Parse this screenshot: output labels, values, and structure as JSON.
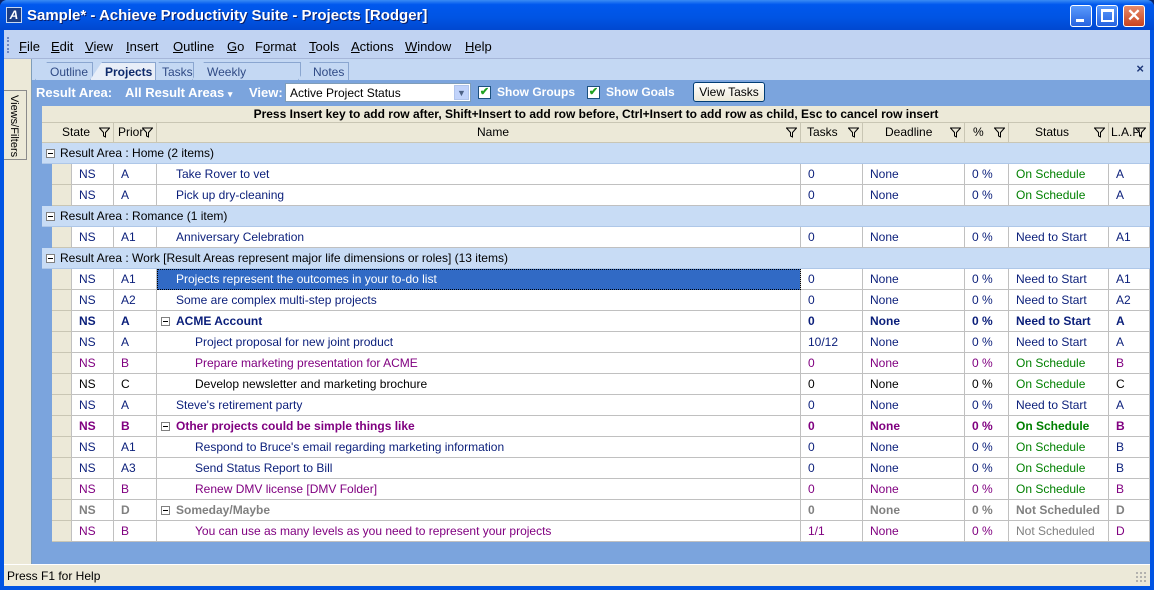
{
  "window": {
    "title": "Sample* - Achieve Productivity Suite - Projects [Rodger]",
    "icon": "app-logo-icon",
    "controls": [
      "minimize",
      "maximize",
      "close"
    ]
  },
  "menu": [
    {
      "label": "File",
      "accel": "F"
    },
    {
      "label": "Edit",
      "accel": "E"
    },
    {
      "label": "View",
      "accel": "V"
    },
    {
      "label": "Insert",
      "accel": "I"
    },
    {
      "label": "Outline",
      "accel": "O"
    },
    {
      "label": "Go",
      "accel": "G"
    },
    {
      "label": "Format",
      "accel": "o"
    },
    {
      "label": "Tools",
      "accel": "T"
    },
    {
      "label": "Actions",
      "accel": "A"
    },
    {
      "label": "Window",
      "accel": "W"
    },
    {
      "label": "Help",
      "accel": "H"
    }
  ],
  "sidebar": {
    "label": "Views/Filters"
  },
  "tabs": [
    {
      "label": "Outline",
      "active": false
    },
    {
      "label": "Projects",
      "active": true
    },
    {
      "label": "Tasks",
      "active": false
    },
    {
      "label": "Weekly Schedule",
      "active": false
    },
    {
      "label": "Notes",
      "active": false
    }
  ],
  "tab_close": "×",
  "filterbar": {
    "result_area_label": "Result Area:",
    "result_area_value": "All Result Areas",
    "view_label": "View:",
    "view_value": "Active Project Status",
    "show_groups_label": "Show Groups",
    "show_groups_checked": true,
    "show_goals_label": "Show Goals",
    "show_goals_checked": true,
    "view_tasks_button": "View Tasks"
  },
  "hint": "Press Insert key to add row after, Shift+Insert to add row before, Ctrl+Insert to add row as child, Esc to cancel row insert",
  "columns": [
    {
      "key": "state",
      "label": "State"
    },
    {
      "key": "prior",
      "label": "Prior"
    },
    {
      "key": "name",
      "label": "Name"
    },
    {
      "key": "tasks",
      "label": "Tasks"
    },
    {
      "key": "deadline",
      "label": "Deadline"
    },
    {
      "key": "pct",
      "label": "%"
    },
    {
      "key": "status",
      "label": "Status"
    },
    {
      "key": "lap",
      "label": "L.A.P."
    }
  ],
  "colors": {
    "navy": "#0a1e7a",
    "purple": "#800080",
    "green": "#008000",
    "gray": "#808080",
    "black": "#000000",
    "selection": "#316ac5",
    "group_bg": "#c8dcf5",
    "pane_bg": "#7ba4dd"
  },
  "groups": [
    {
      "label": "Result Area : Home (2 items)",
      "rows": [
        {
          "state": "NS",
          "prior": "A",
          "name": "Take Rover to vet",
          "tasks": "0",
          "deadline": "None",
          "pct": "0 %",
          "status": "On Schedule",
          "lap": "A",
          "level": 0,
          "color": "navy",
          "status_color": "green",
          "bold": false
        },
        {
          "state": "NS",
          "prior": "A",
          "name": "Pick up dry-cleaning",
          "tasks": "0",
          "deadline": "None",
          "pct": "0 %",
          "status": "On Schedule",
          "lap": "A",
          "level": 0,
          "color": "navy",
          "status_color": "green",
          "bold": false
        }
      ]
    },
    {
      "label": "Result Area : Romance (1 item)",
      "rows": [
        {
          "state": "NS",
          "prior": "A1",
          "name": "Anniversary Celebration",
          "tasks": "0",
          "deadline": "None",
          "pct": "0 %",
          "status": "Need to Start",
          "lap": "A1",
          "level": 0,
          "color": "navy",
          "status_color": "navy",
          "bold": false
        }
      ]
    },
    {
      "label": "Result Area : Work [Result Areas represent major life dimensions or roles] (13 items)",
      "rows": [
        {
          "state": "NS",
          "prior": "A1",
          "name": "Projects represent the outcomes in your to-do list",
          "tasks": "0",
          "deadline": "None",
          "pct": "0 %",
          "status": "Need to Start",
          "lap": "A1",
          "level": 0,
          "color": "navy",
          "status_color": "navy",
          "bold": false,
          "selected": true
        },
        {
          "state": "NS",
          "prior": "A2",
          "name": "Some are complex multi-step projects",
          "tasks": "0",
          "deadline": "None",
          "pct": "0 %",
          "status": "Need to Start",
          "lap": "A2",
          "level": 0,
          "color": "navy",
          "status_color": "navy",
          "bold": false
        },
        {
          "state": "NS",
          "prior": "A",
          "name": "ACME Account",
          "tasks": "0",
          "deadline": "None",
          "pct": "0 %",
          "status": "Need to Start",
          "lap": "A",
          "level": 0,
          "color": "navy",
          "status_color": "navy",
          "bold": true,
          "expander": true
        },
        {
          "state": "NS",
          "prior": "A",
          "name": "Project proposal for new joint product",
          "tasks": "10/12",
          "deadline": "None",
          "pct": "0 %",
          "status": "Need to Start",
          "lap": "A",
          "level": 1,
          "color": "navy",
          "status_color": "navy",
          "bold": false
        },
        {
          "state": "NS",
          "prior": "B",
          "name": "Prepare marketing presentation for ACME",
          "tasks": "0",
          "deadline": "None",
          "pct": "0 %",
          "status": "On Schedule",
          "lap": "B",
          "level": 1,
          "color": "purple",
          "status_color": "green",
          "bold": false
        },
        {
          "state": "NS",
          "prior": "C",
          "name": "Develop newsletter and marketing brochure",
          "tasks": "0",
          "deadline": "None",
          "pct": "0 %",
          "status": "On Schedule",
          "lap": "C",
          "level": 1,
          "color": "black",
          "status_color": "green",
          "bold": false
        },
        {
          "state": "NS",
          "prior": "A",
          "name": "Steve's retirement party",
          "tasks": "0",
          "deadline": "None",
          "pct": "0 %",
          "status": "Need to Start",
          "lap": "A",
          "level": 0,
          "color": "navy",
          "status_color": "navy",
          "bold": false
        },
        {
          "state": "NS",
          "prior": "B",
          "name": "Other projects could be simple things like",
          "tasks": "0",
          "deadline": "None",
          "pct": "0 %",
          "status": "On Schedule",
          "lap": "B",
          "level": 0,
          "color": "purple",
          "status_color": "green",
          "bold": true,
          "expander": true
        },
        {
          "state": "NS",
          "prior": "A1",
          "name": "Respond to Bruce's email regarding marketing information",
          "tasks": "0",
          "deadline": "None",
          "pct": "0 %",
          "status": "On Schedule",
          "lap": "B",
          "level": 1,
          "color": "navy",
          "status_color": "green",
          "bold": false
        },
        {
          "state": "NS",
          "prior": "A3",
          "name": "Send Status Report to Bill",
          "tasks": "0",
          "deadline": "None",
          "pct": "0 %",
          "status": "On Schedule",
          "lap": "B",
          "level": 1,
          "color": "navy",
          "status_color": "green",
          "bold": false
        },
        {
          "state": "NS",
          "prior": "B",
          "name": "Renew DMV license [DMV Folder]",
          "tasks": "0",
          "deadline": "None",
          "pct": "0 %",
          "status": "On Schedule",
          "lap": "B",
          "level": 1,
          "color": "purple",
          "status_color": "green",
          "bold": false
        },
        {
          "state": "NS",
          "prior": "D",
          "name": "Someday/Maybe",
          "tasks": "0",
          "deadline": "None",
          "pct": "0 %",
          "status": "Not Scheduled",
          "lap": "D",
          "level": 0,
          "color": "gray",
          "status_color": "gray",
          "bold": true,
          "expander": true
        },
        {
          "state": "NS",
          "prior": "B",
          "name": "You can use as many levels as you need to represent your projects",
          "tasks": "1/1",
          "deadline": "None",
          "pct": "0 %",
          "status": "Not Scheduled",
          "lap": "D",
          "level": 1,
          "color": "purple",
          "status_color": "gray",
          "bold": false
        }
      ]
    }
  ],
  "statusbar": {
    "text": "Press F1 for Help"
  }
}
